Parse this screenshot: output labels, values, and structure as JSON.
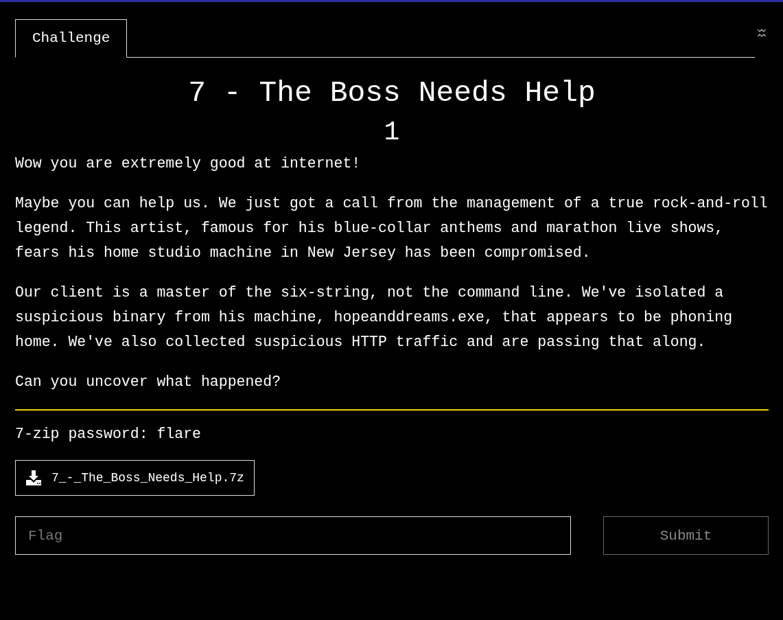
{
  "tabs": [
    {
      "label": "Challenge",
      "selected": true
    }
  ],
  "challenge": {
    "title": "7 - The Boss Needs Help",
    "points": "1",
    "paragraphs": [
      "Wow you are extremely good at internet!",
      "Maybe you can help us. We just got a call from the management of a true rock-and-roll legend. This artist, famous for his blue-collar anthems and marathon live shows, fears his home studio machine in New Jersey has been compromised.",
      "Our client is a master of the six-string, not the command line. We've isolated a suspicious binary from his machine, hopeanddreams.exe, that appears to be phoning home. We've also collected suspicious HTTP traffic and are passing that along.",
      "Can you uncover what happened?"
    ],
    "note": "7-zip password: flare",
    "files": [
      {
        "name": "7_-_The_Boss_Needs_Help.7z"
      }
    ]
  },
  "flag_form": {
    "placeholder": "Flag",
    "submit": {
      "label": "Submit",
      "disabled": true
    }
  }
}
